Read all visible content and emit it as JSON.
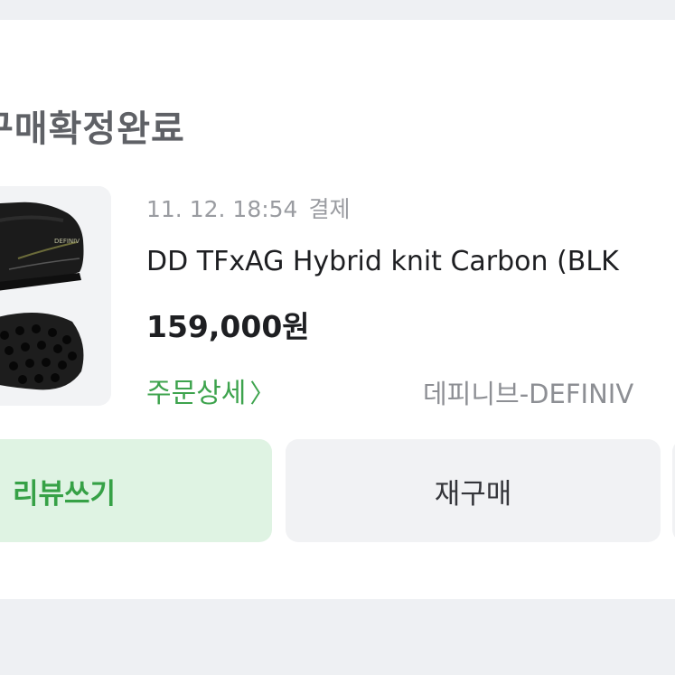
{
  "order": {
    "status": "구매확정완료",
    "date": "11. 12. 18:54",
    "payment_status": "결제",
    "product_name": "DD TFxAG Hybrid knit Carbon (BLK",
    "price": "159,000원",
    "detail_link": "주문상세",
    "seller": "데피니브-DEFINIV"
  },
  "actions": {
    "review_label": "리뷰쓰기",
    "rebuy_label": "재구매"
  },
  "colors": {
    "accent_green": "#3da34d",
    "review_bg": "#dff3e3",
    "page_bg": "#eef0f3"
  },
  "icons": {
    "detail_chevron": "chevron-right-icon"
  }
}
